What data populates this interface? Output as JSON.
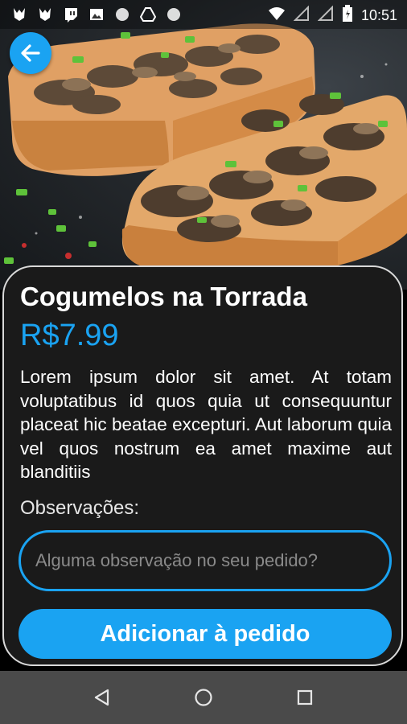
{
  "status_bar": {
    "time": "10:51",
    "icons": [
      "app-icon-1",
      "app-icon-2",
      "twitch-icon",
      "image-icon",
      "circle-icon",
      "drive-icon",
      "circle-icon-2",
      "wifi-icon",
      "signal-icon",
      "signal-icon-2",
      "battery-icon"
    ]
  },
  "product": {
    "title": "Cogumelos na Torrada",
    "price": "R$7.99",
    "description": "Lorem ipsum dolor sit amet. At totam voluptatibus id quos quia ut consequuntur placeat hic beatae excepturi. Aut laborum quia vel quos nostrum ea amet maxime aut blanditiis"
  },
  "notes": {
    "label": "Observações:",
    "placeholder": "Alguma observação no seu pedido?",
    "value": ""
  },
  "actions": {
    "add_label": "Adicionar à pedido"
  },
  "colors": {
    "accent": "#1aa3f2",
    "card_bg": "#1a1a1a",
    "card_border": "#d9d9d9",
    "nav_bg": "#4a4a4a"
  },
  "icons": {
    "back": "arrow-left-icon",
    "nav_back": "triangle-back-icon",
    "nav_home": "circle-home-icon",
    "nav_recents": "square-recents-icon"
  }
}
